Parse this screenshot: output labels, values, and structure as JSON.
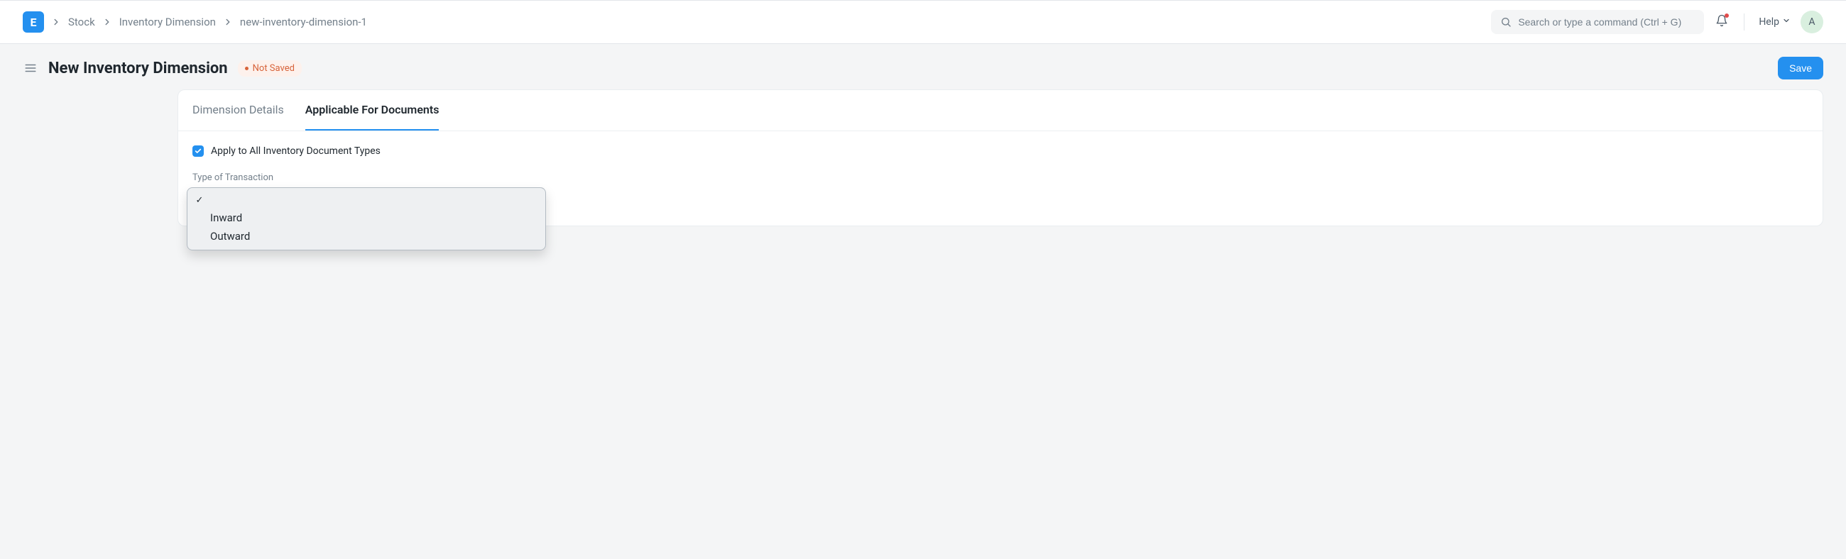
{
  "brand": {
    "letter": "E"
  },
  "breadcrumbs": {
    "items": [
      "Stock",
      "Inventory Dimension",
      "new-inventory-dimension-1"
    ]
  },
  "search": {
    "placeholder": "Search or type a command (Ctrl + G)"
  },
  "help": {
    "label": "Help"
  },
  "user": {
    "initial": "A"
  },
  "page": {
    "title": "New Inventory Dimension",
    "status": "Not Saved",
    "save_label": "Save"
  },
  "tabs": {
    "details": "Dimension Details",
    "applicable": "Applicable For Documents"
  },
  "form": {
    "apply_all_label": "Apply to All Inventory Document Types",
    "apply_all_checked": true,
    "transaction_label": "Type of Transaction",
    "transaction_options": {
      "blank": "",
      "inward": "Inward",
      "outward": "Outward"
    },
    "selected_option": ""
  }
}
